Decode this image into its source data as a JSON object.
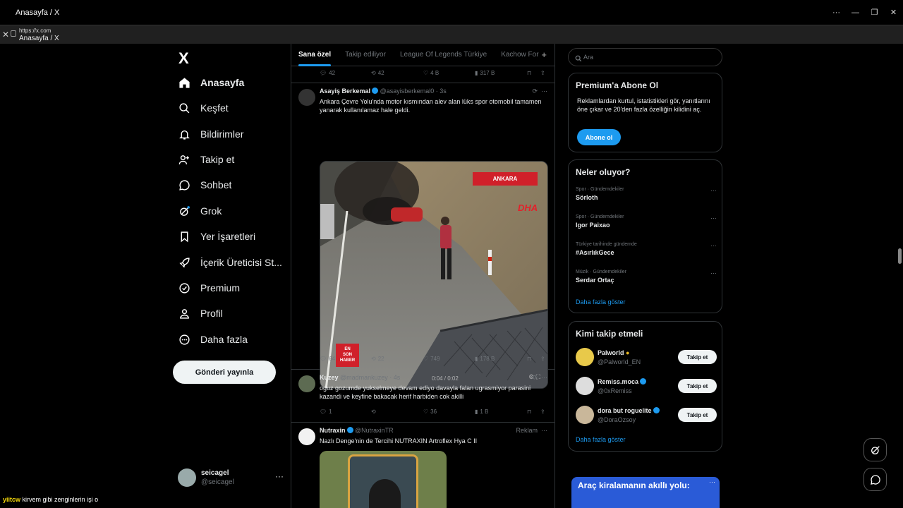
{
  "window": {
    "title": "Anasayfa / X"
  },
  "urlbar": {
    "url": "https://x.com",
    "page_title": "Anasayfa / X"
  },
  "nav": {
    "logo": "X",
    "items": [
      {
        "label": "Anasayfa",
        "icon": "home-icon"
      },
      {
        "label": "Keşfet",
        "icon": "search-icon"
      },
      {
        "label": "Bildirimler",
        "icon": "bell-icon"
      },
      {
        "label": "Takip et",
        "icon": "person-plus-icon"
      },
      {
        "label": "Sohbet",
        "icon": "chat-icon"
      },
      {
        "label": "Grok",
        "icon": "grok-icon"
      },
      {
        "label": "Yer İşaretleri",
        "icon": "bookmark-icon"
      },
      {
        "label": "İçerik Üreticisi St...",
        "icon": "rocket-icon"
      },
      {
        "label": "Premium",
        "icon": "verified-icon"
      },
      {
        "label": "Profil",
        "icon": "person-icon"
      },
      {
        "label": "Daha fazla",
        "icon": "more-circle-icon"
      }
    ],
    "post_button": "Gönderi yayınla",
    "account": {
      "name": "seicagel",
      "handle": "@seicagel"
    }
  },
  "tabs": [
    "Sana özel",
    "Takip ediliyor",
    "League Of Legends Türkiye",
    "Kachow For"
  ],
  "top_actions": {
    "replies": "42",
    "reposts": "42",
    "likes": "4 B",
    "views": "317 B"
  },
  "tweets": [
    {
      "name": "Asayiş Berkemal",
      "handle": "@asayisberkemal0 · 3s",
      "text": "Ankara Çevre Yolu'nda motor kısmından alev alan lüks spor otomobil tamamen yanarak kullanılamaz hale geldi.",
      "media": {
        "location_tag": "ANKARA",
        "agency": "DHA",
        "corner_logo_1": "EN",
        "corner_logo_2": "SON",
        "corner_logo_3": "HABER",
        "timecode": "0:04 / 0:02"
      },
      "actions": {
        "replies": "64",
        "reposts": "22",
        "likes": "749",
        "views": "178 B"
      }
    },
    {
      "name": "Kuzey",
      "handle": "@madmankuzey · 4s",
      "text": "oguz gozumde yukselmeye devam ediyo davayla falan ugrasmiyor parasini kazandi ve keyfine bakacak herif harbiden cok akilli",
      "actions": {
        "replies": "1",
        "reposts": "",
        "likes": "36",
        "views": "1 B"
      }
    },
    {
      "name": "Nutraxin",
      "handle": "@NutraxinTR",
      "ad_label": "Reklam",
      "text": "Nazlı Denge'nin de Tercihi NUTRAXIN Artroflex Hya C II"
    }
  ],
  "right": {
    "search_placeholder": "Ara",
    "premium": {
      "title": "Premium'a Abone Ol",
      "body": "Reklamlardan kurtul, istatistikleri gör, yanıtlarını öne çıkar ve 20'den fazla özelliğin kilidini aç.",
      "button": "Abone ol"
    },
    "trends": {
      "title": "Neler oluyor?",
      "items": [
        {
          "context": "Spor · Gündemdekiler",
          "topic": "Sörloth"
        },
        {
          "context": "Spor · Gündemdekiler",
          "topic": "Igor Paixao"
        },
        {
          "context": "Türkiye tarihinde gündemde",
          "topic": "#AsırlıkGece"
        },
        {
          "context": "Müzik · Gündemdekiler",
          "topic": "Serdar Ortaç"
        }
      ],
      "more": "Daha fazla göster"
    },
    "who": {
      "title": "Kimi takip etmeli",
      "items": [
        {
          "name": "Palworld",
          "handle": "@Palworld_EN",
          "button": "Takip et"
        },
        {
          "name": "Remiss.moca",
          "handle": "@0xRemiss",
          "button": "Takip et"
        },
        {
          "name": "dora but roguelite",
          "handle": "@DoraOzsoy",
          "button": "Takip et"
        }
      ],
      "more": "Daha fazla göster"
    },
    "ad_banner": "Araç kiralamanın akıllı yolu:"
  },
  "overlay": {
    "user": "yiitcw",
    "message": "kirvem gibi zenginlerin işi o"
  }
}
